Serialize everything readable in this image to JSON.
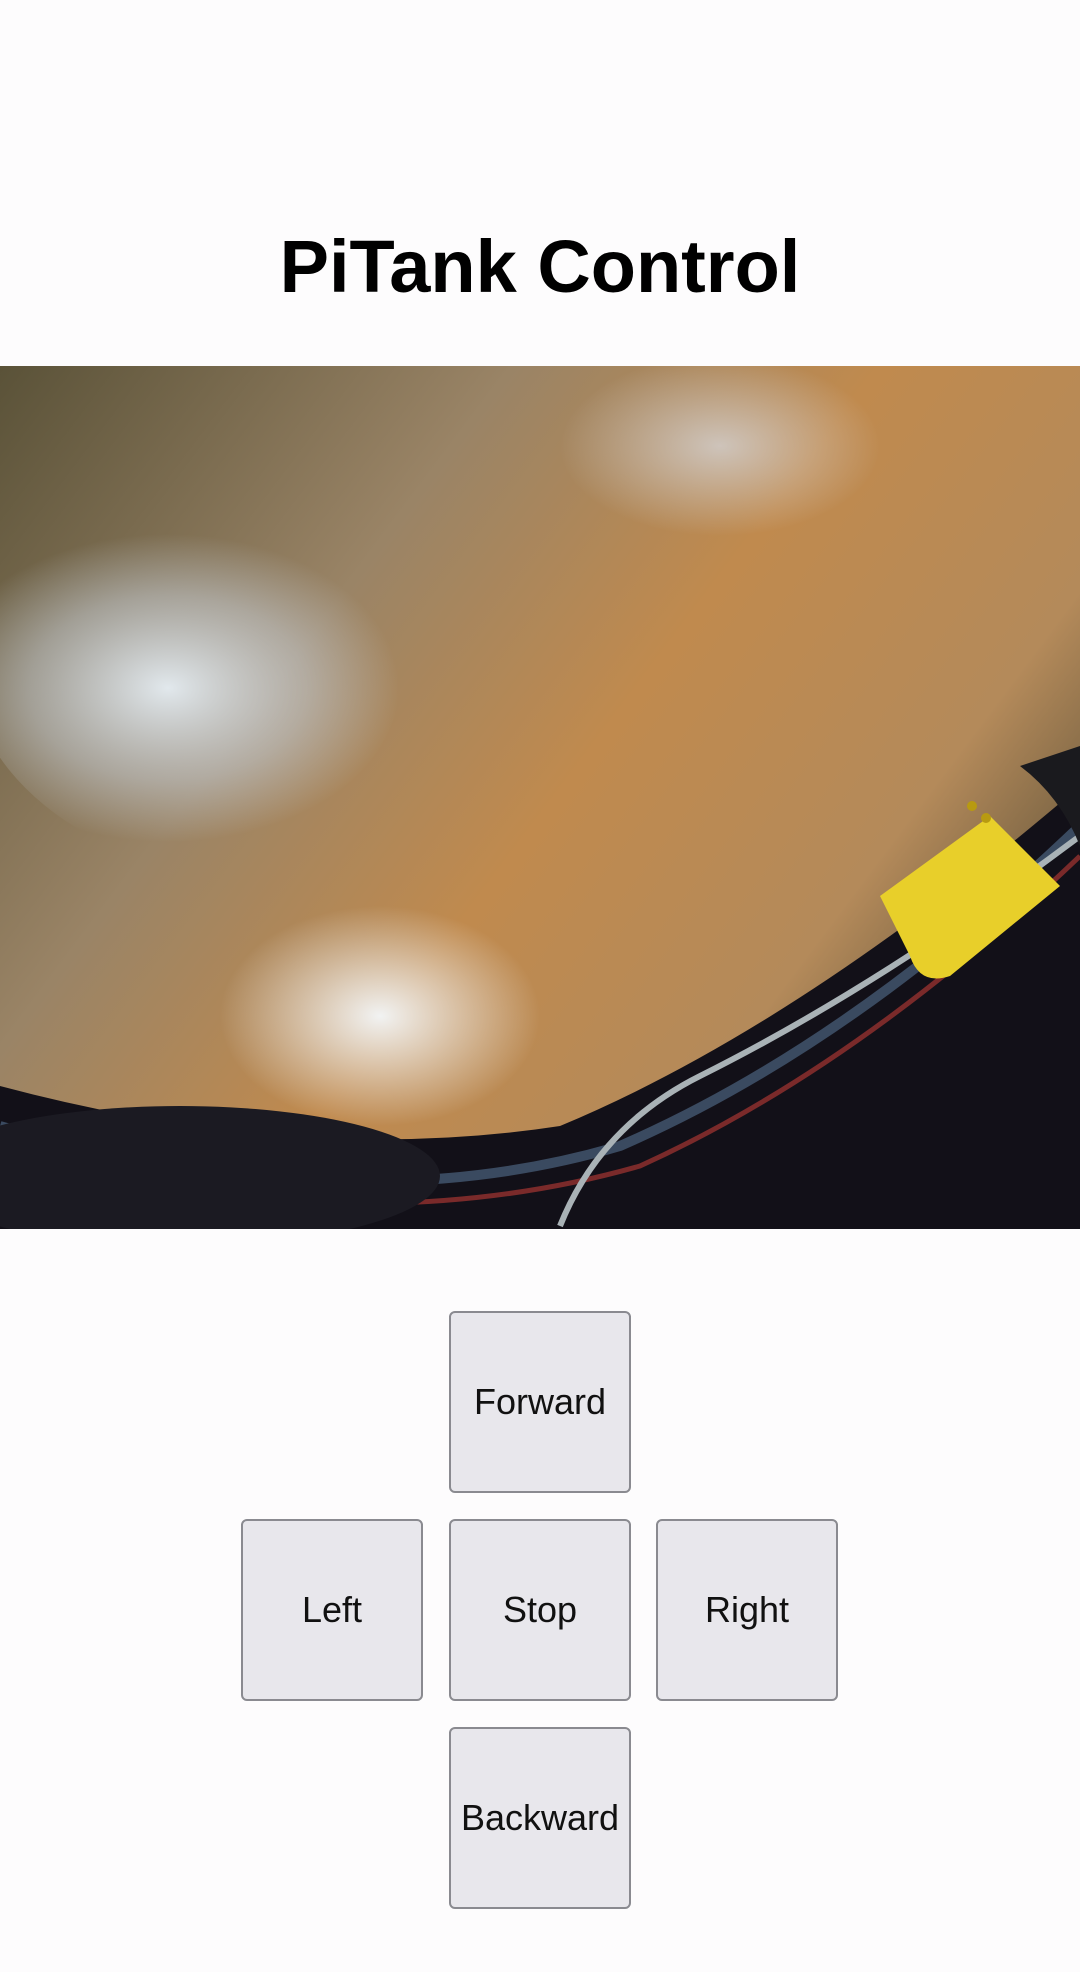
{
  "header": {
    "title": "PiTank Control"
  },
  "camera_feed": {
    "description_icon": "camera-feed"
  },
  "controls": {
    "forward_label": "Forward",
    "left_label": "Left",
    "stop_label": "Stop",
    "right_label": "Right",
    "backward_label": "Backward"
  },
  "colors": {
    "button_bg": "#e8e7ec",
    "button_border": "#8a8a90",
    "page_bg": "#fdfcfd"
  }
}
